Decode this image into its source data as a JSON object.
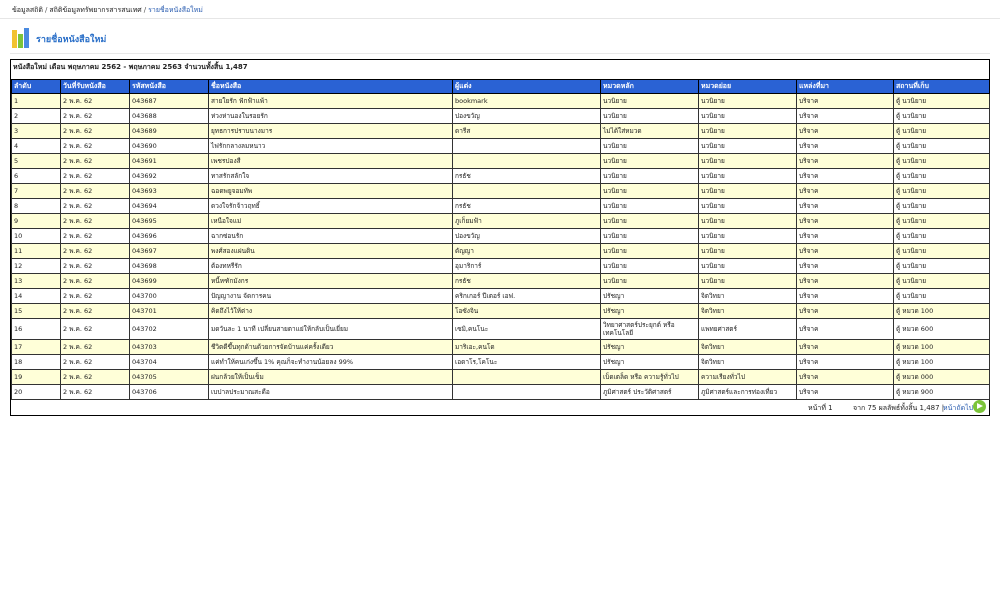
{
  "breadcrumb": {
    "items": [
      "ข้อมูลสถิติ",
      "สถิติข้อมูลทรัพยากรสารสนเทศ"
    ],
    "current": "รายชื่อหนังสือใหม่"
  },
  "page": {
    "title": "รายชื่อหนังสือใหม่"
  },
  "summary": "หนังสือใหม่ เดือน พฤษภาคม 2562 - พฤษภาคม 2563  จำนวนทั้งสิ้น 1,487",
  "colors": {
    "header_bg": "#2a62d4",
    "odd_row": "#ffffd8",
    "title": "#2a6fc8"
  },
  "table": {
    "columns": [
      "ลำดับ",
      "วันที่รับหนังสือ",
      "รหัสหนังสือ",
      "ชื่อหนังสือ",
      "ผู้แต่ง",
      "หมวดหลัก",
      "หมวดย่อย",
      "แหล่งที่มา",
      "สถานที่เก็บ"
    ],
    "rows": [
      [
        "1",
        "2 พ.ค. 62",
        "043687",
        "สายใยรัก ฟักฟ้าแพ้า",
        "bookmark",
        "นวนิยาย",
        "นวนิยาย",
        "บริจาค",
        "ตู้ นวนิยาย"
      ],
      [
        "2",
        "2 พ.ค. 62",
        "043688",
        "ห่วงห่านองในรอยรัก",
        "ปองขวัญ",
        "นวนิยาย",
        "นวนิยาย",
        "บริจาค",
        "ตู้ นวนิยาย"
      ],
      [
        "3",
        "2 พ.ค. 62",
        "043689",
        "ยุทธการปราบนางมาร",
        "ดารีส",
        "ไม่ได้ใส่หมวด",
        "นวนิยาย",
        "บริจาค",
        "ตู้ นวนิยาย"
      ],
      [
        "4",
        "2 พ.ค. 62",
        "043690",
        "ไฟรักกลางลมหนาว",
        "",
        "นวนิยาย",
        "นวนิยาย",
        "บริจาค",
        "ตู้ นวนิยาย"
      ],
      [
        "5",
        "2 พ.ค. 62",
        "043691",
        "เพชรปองสี",
        "",
        "นวนิยาย",
        "นวนิยาย",
        "บริจาค",
        "ตู้ นวนิยาย"
      ],
      [
        "6",
        "2 พ.ค. 62",
        "043692",
        "ทาสรักสลักใจ",
        "กรธัช",
        "นวนิยาย",
        "นวนิยาย",
        "บริจาค",
        "ตู้ นวนิยาย"
      ],
      [
        "7",
        "2 พ.ค. 62",
        "043693",
        "ฉอดพยูจอมทัพ",
        "",
        "นวนิยาย",
        "นวนิยาย",
        "บริจาค",
        "ตู้ นวนิยาย"
      ],
      [
        "8",
        "2 พ.ค. 62",
        "043694",
        "ดวงใจรักจ้าวฤทธิ์",
        "กรธัช",
        "นวนิยาย",
        "นวนิยาย",
        "บริจาค",
        "ตู้ นวนิยาย"
      ],
      [
        "9",
        "2 พ.ค. 62",
        "043695",
        "เหนือใจแม่",
        "ภูเก็ยมฟ้า",
        "นวนิยาย",
        "นวนิยาย",
        "บริจาค",
        "ตู้ นวนิยาย"
      ],
      [
        "10",
        "2 พ.ค. 62",
        "043696",
        "ฉากซ่อนรัก",
        "ปองขวัญ",
        "นวนิยาย",
        "นวนิยาย",
        "บริจาค",
        "ตู้ นวนิยาย"
      ],
      [
        "11",
        "2 พ.ค. 62",
        "043697",
        "พงศ์สองแผ่นดิน",
        "ดัญญา",
        "นวนิยาย",
        "นวนิยาย",
        "บริจาค",
        "ตู้ นวนิยาย"
      ],
      [
        "12",
        "2 พ.ค. 62",
        "043698",
        "ต้องทหรีรัก",
        "อุมาริการ์",
        "นวนิยาย",
        "นวนิยาย",
        "บริจาค",
        "ตู้ นวนิยาย"
      ],
      [
        "13",
        "2 พ.ค. 62",
        "043699",
        "หนี้หฑักมังกร",
        "กรธัช",
        "นวนิยาย",
        "นวนิยาย",
        "บริจาค",
        "ตู้ นวนิยาย"
      ],
      [
        "14",
        "2 พ.ค. 62",
        "043700",
        "ปัญญางาน จัดการคน",
        "คริกเกอร์ ปีเตอร์ เอฟ.",
        "ปรัชญา",
        "จิตวิทยา",
        "บริจาค",
        "ตู้ นวนิยาย"
      ],
      [
        "15",
        "2 พ.ค. 62",
        "043701",
        "คิดถึงไว้ให้ต่าง",
        "โอซังจิน",
        "ปรัชญา",
        "จิตวิทยา",
        "บริจาค",
        "ตู้ หมวด 100"
      ],
      [
        "16",
        "2 พ.ค. 62",
        "043702",
        "มดวันละ 1 นาที เปลี่ยนสายตาแย่ให้กลับเป็นเยี่ยม",
        "เซมิ,คนโนะ",
        "วิทยาศาสตร์ประยุกต์ หรือเทคโนโลยี",
        "แพทยศาสตร์",
        "บริจาค",
        "ตู้ หมวด 600"
      ],
      [
        "17",
        "2 พ.ค. 62",
        "043703",
        "ชีวิตดีขึ้นทุกด้านด้วยการจัดบ้านแค่ครั้งเดียว",
        "มาริเอะ,คนโด",
        "ปรัชญา",
        "จิตวิทยา",
        "บริจาค",
        "ตู้ หมวด 100"
      ],
      [
        "18",
        "2 พ.ค. 62",
        "043704",
        "แค่ทำให้คนเก่งขึ้น 1% คุณก็จะทำงานน้อยลง 99%",
        "เอดาโร,โคโนะ",
        "ปรัชญา",
        "จิตวิทยา",
        "บริจาค",
        "ตู้ หมวด 100"
      ],
      [
        "19",
        "2 พ.ค. 62",
        "043705",
        "ฝนกล้วยให้เป็นเข็ม",
        "",
        "เบ็ดเตล็ด หรือ ความรู้ทั่วไป",
        "ความเรียงทั่วไป",
        "บริจาค",
        "ตู้ หมวด 000"
      ],
      [
        "20",
        "2 พ.ค. 62",
        "043706",
        "เบปาลประมาณสะดือ",
        "",
        "ภูมิศาสตร์ ประวัติศาสตร์",
        "ภูมิศาสตร์และการท่องเที่ยว",
        "บริจาค",
        "ตู้ หมวด 900"
      ]
    ]
  },
  "footer": {
    "page_label": "หน้าที่ 1",
    "total_label": "จาก 75   ผลลัพธ์ทั้งสิ้น 1,487   |",
    "next_label": "หน้าถัดไป",
    "next_icon": "arrow-right-icon"
  }
}
